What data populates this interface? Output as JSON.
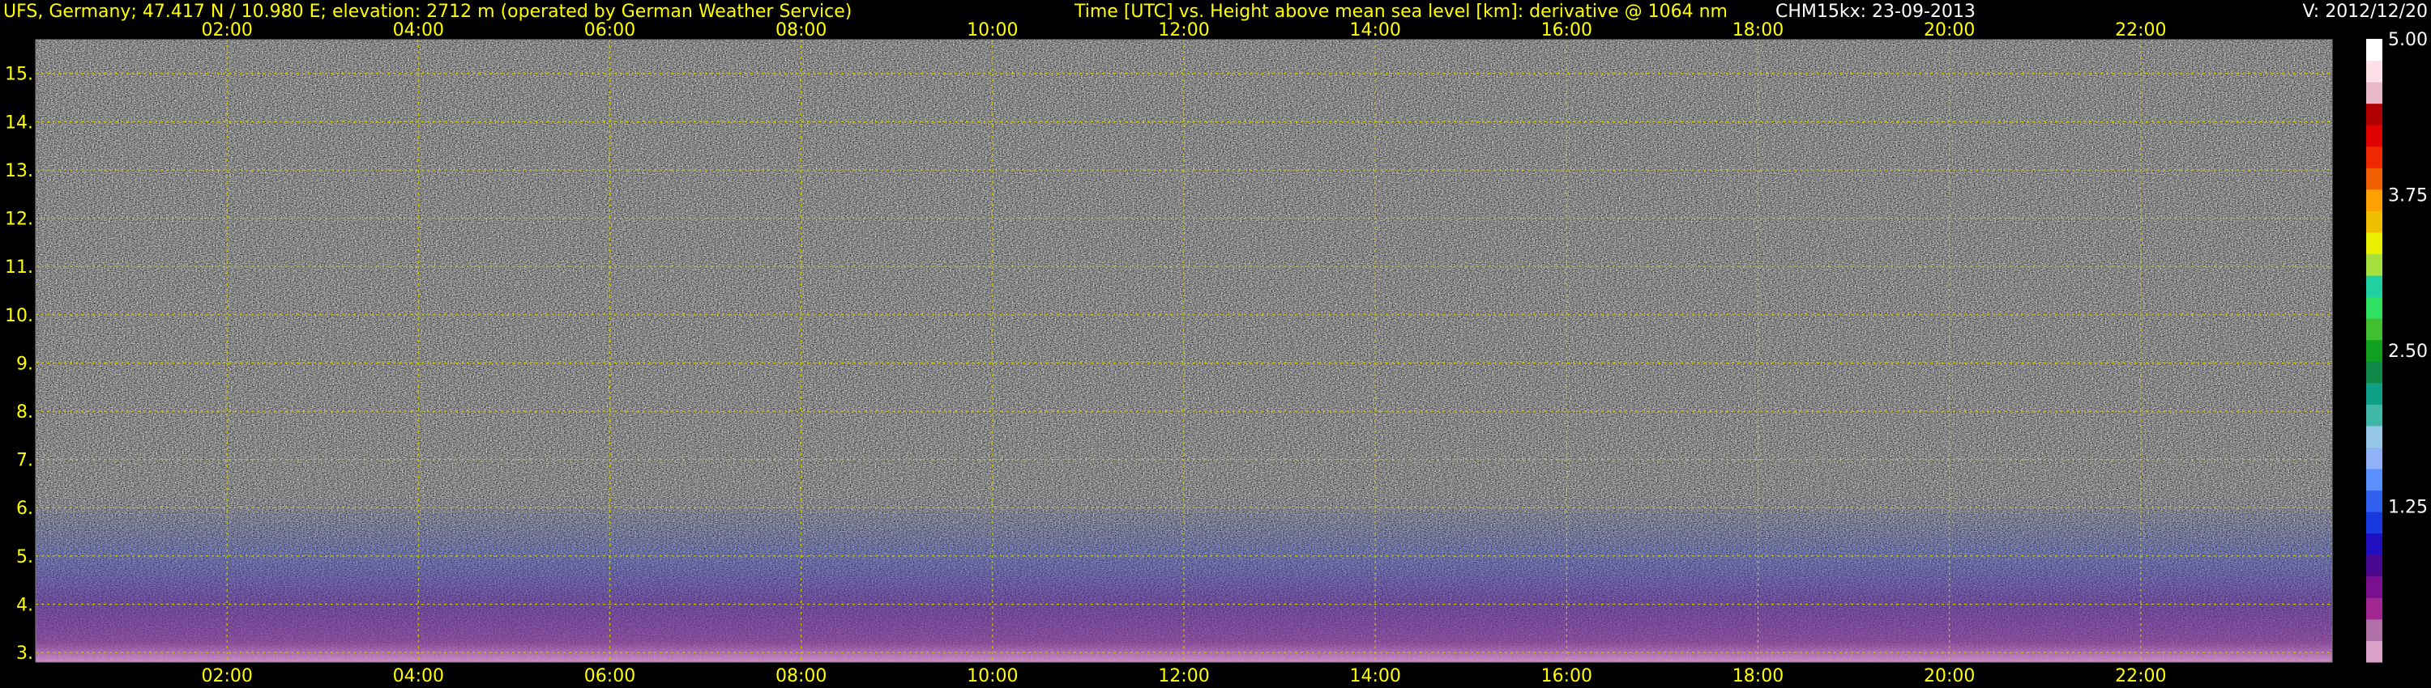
{
  "header": {
    "station": "UFS, Germany; 47.417 N / 10.980 E; elevation: 2712 m  (operated by German Weather Service)",
    "title": "Time [UTC] vs. Height above mean sea level [km]: derivative @ 1064 nm",
    "instrument": "CHM15kx: 23-09-2013",
    "version": "V: 2012/12/20"
  },
  "colors": {
    "text": "#ffff00",
    "grid": "#c8c800",
    "background": "#000000"
  },
  "chart_data": {
    "type": "heatmap",
    "title": "Time [UTC] vs. Height above mean sea level [km]: derivative @ 1064 nm",
    "xlabel": "Time [UTC]",
    "ylabel": "Height above mean sea level [km]",
    "xlim": [
      "00:00",
      "24:00"
    ],
    "ylim": [
      2.8,
      15.7
    ],
    "x_ticks": [
      "02:00",
      "04:00",
      "06:00",
      "08:00",
      "10:00",
      "12:00",
      "14:00",
      "16:00",
      "18:00",
      "20:00",
      "22:00"
    ],
    "x_tick_hours": [
      2,
      4,
      6,
      8,
      10,
      12,
      14,
      16,
      18,
      20,
      22
    ],
    "y_ticks": [
      "3.",
      "4.",
      "5.",
      "6.",
      "7.",
      "8.",
      "9.",
      "10.",
      "11.",
      "12.",
      "13.",
      "14.",
      "15."
    ],
    "y_tick_values": [
      3,
      4,
      5,
      6,
      7,
      8,
      9,
      10,
      11,
      12,
      13,
      14,
      15
    ],
    "grid": true,
    "colorbar": {
      "range": [
        0,
        5
      ],
      "tick_labels": [
        "5.00",
        "3.75",
        "2.50",
        "1.25"
      ],
      "tick_values": [
        5.0,
        3.75,
        2.5,
        1.25
      ],
      "colors": [
        "#d9a0c8",
        "#b070a8",
        "#a02890",
        "#7a1090",
        "#4a0a90",
        "#2010c0",
        "#1838e0",
        "#3060f0",
        "#5a90ff",
        "#90b0f8",
        "#98c8e8",
        "#40b8a8",
        "#10a088",
        "#108848",
        "#10a020",
        "#40c030",
        "#30e060",
        "#20d0a0",
        "#a8e040",
        "#e8f000",
        "#f0c000",
        "#ffa000",
        "#f06000",
        "#f02800",
        "#e00000",
        "#b00000",
        "#e8b8c8",
        "#ffe0e8",
        "#ffffff"
      ]
    }
  }
}
